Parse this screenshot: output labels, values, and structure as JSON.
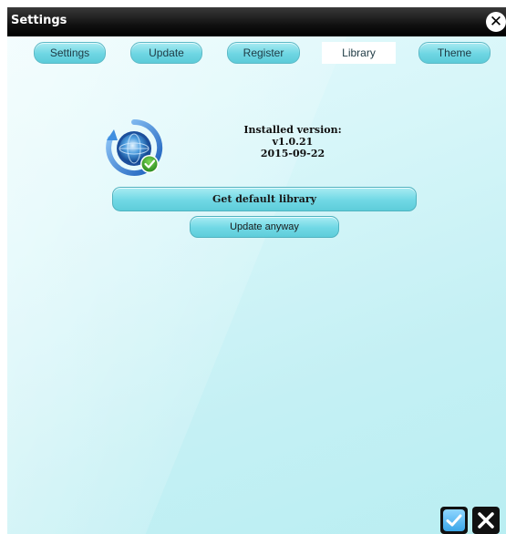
{
  "window": {
    "title": "Settings"
  },
  "tabs": [
    {
      "label": "Settings",
      "active": false
    },
    {
      "label": "Update",
      "active": false
    },
    {
      "label": "Register",
      "active": false
    },
    {
      "label": "Library",
      "active": true
    },
    {
      "label": "Theme",
      "active": false
    }
  ],
  "library": {
    "icon": "globe-sync-check-icon",
    "installed_label": "Installed version:",
    "version": "v1.0.21",
    "date": "2015-09-22",
    "get_default_label": "Get default library",
    "update_anyway_label": "Update anyway"
  },
  "footer": {
    "ok_icon": "checkmark-icon",
    "cancel_icon": "close-icon"
  },
  "colors": {
    "accent": "#6ed6e3",
    "background": "#d7f6f9",
    "titlebar": "#111111"
  }
}
